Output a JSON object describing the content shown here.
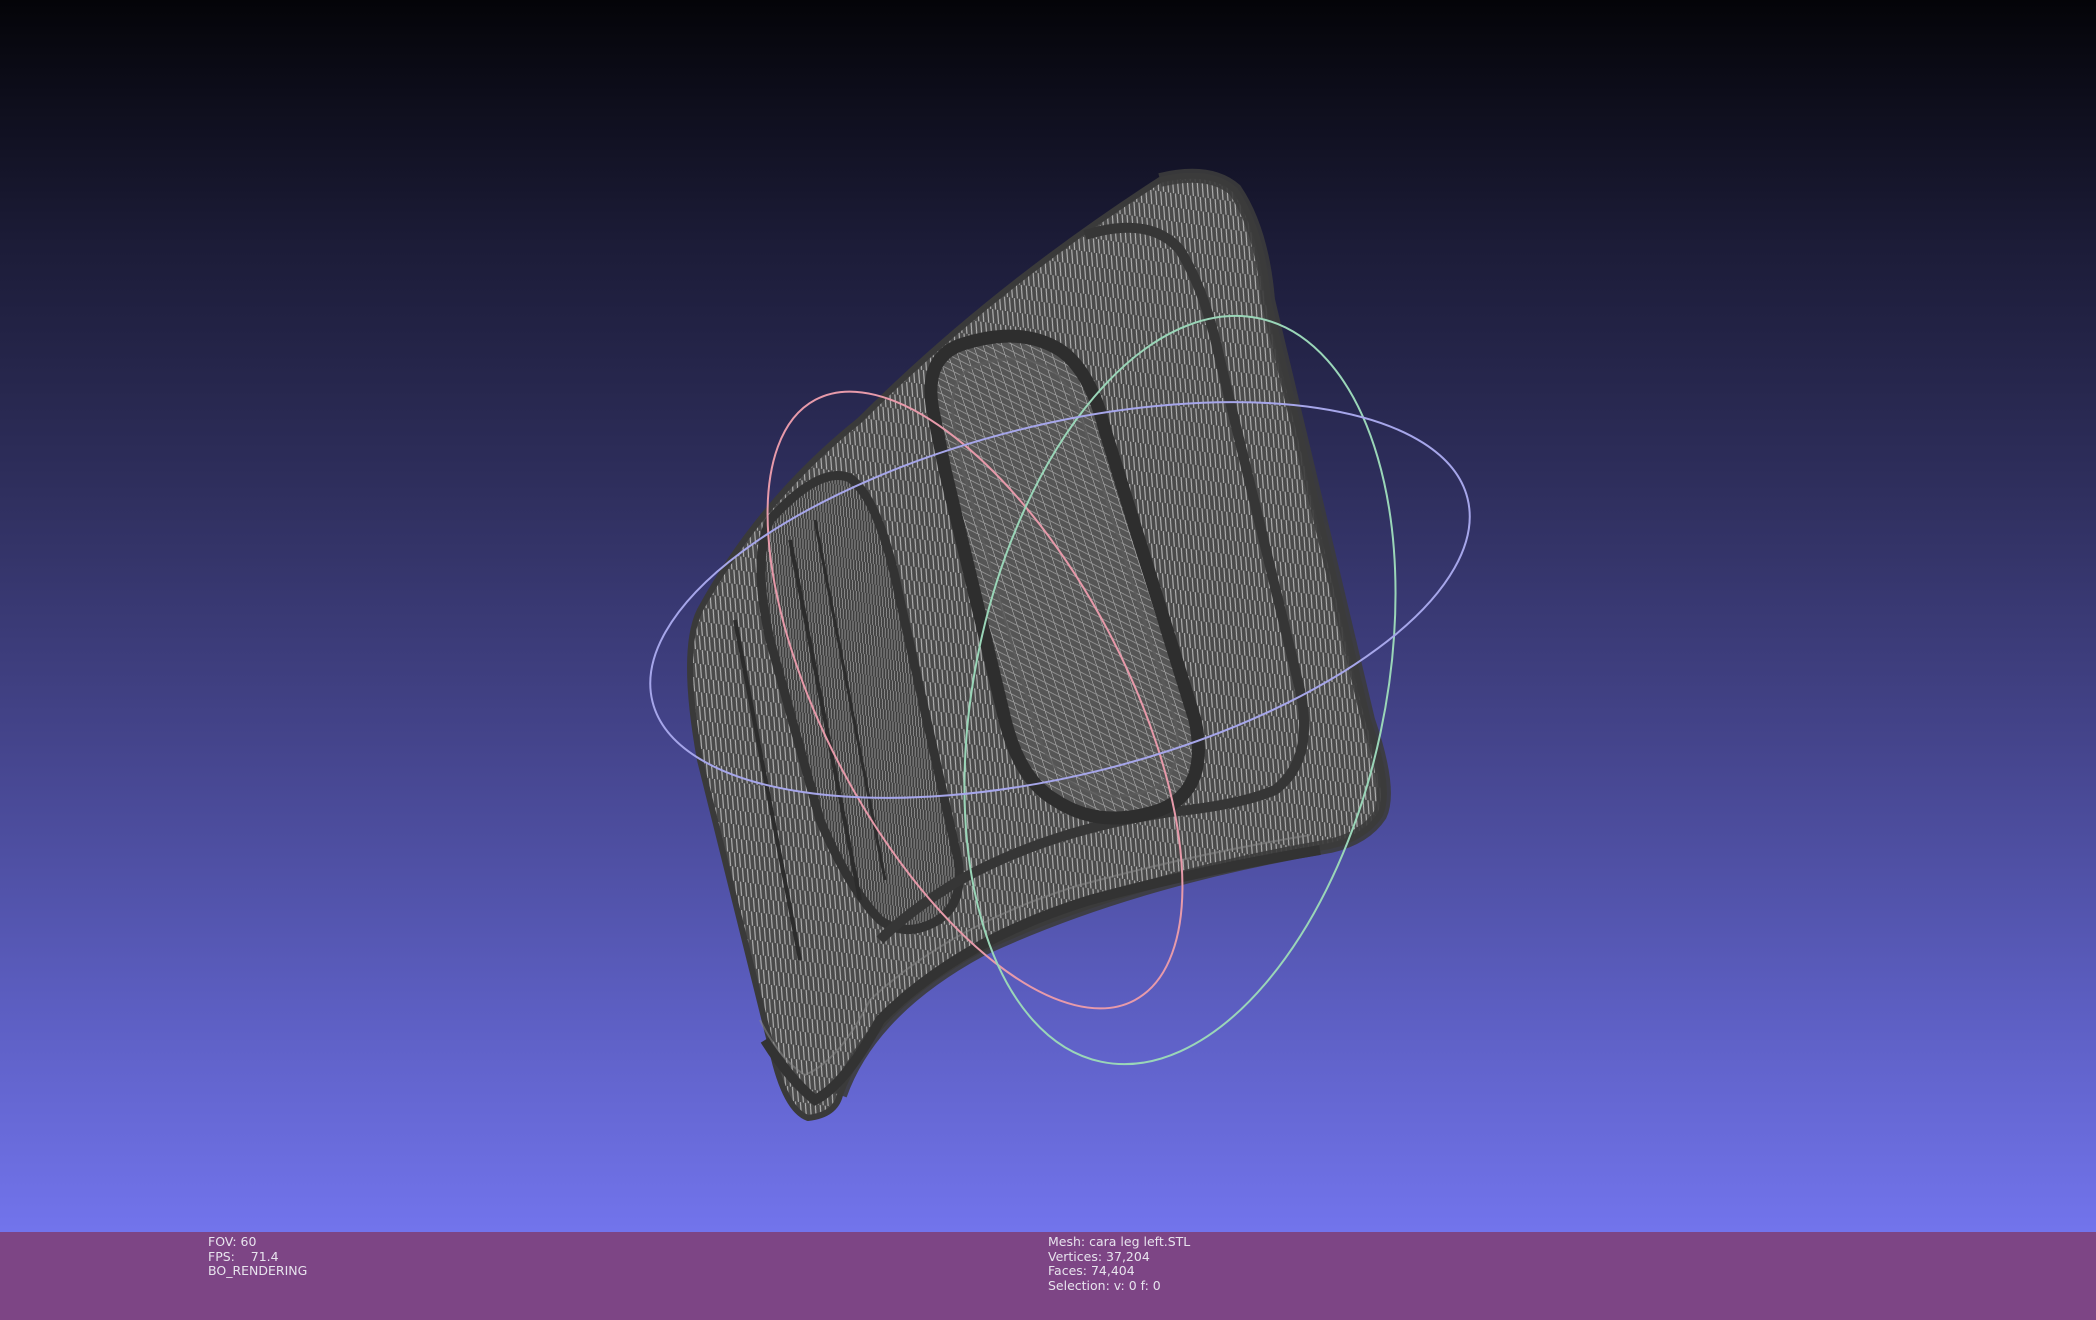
{
  "viewer": {
    "mesh_color": "#4a4a4a",
    "wire_color": "#b8b8b8",
    "trackball_colors": {
      "red_ring": "#e79aaa",
      "green_ring": "#9ad6b8",
      "blue_ring": "#a6a6ea"
    }
  },
  "status": {
    "fov": "FOV: 60",
    "fps": "FPS:    71.4",
    "render_mode": "BO_RENDERING",
    "mesh": "Mesh: cara leg left.STL",
    "vertices": "Vertices: 37,204",
    "faces": "Faces: 74,404",
    "selection": "Selection: v: 0 f: 0"
  }
}
